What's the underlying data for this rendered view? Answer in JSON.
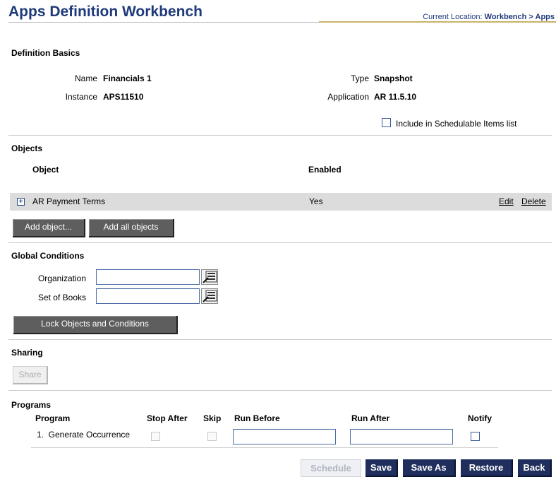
{
  "header": {
    "title": "Apps Definition Workbench",
    "location_label": "Current Location:",
    "location_path": "Workbench > Apps"
  },
  "basics": {
    "section_title": "Definition Basics",
    "name_label": "Name",
    "name_value": "Financials 1",
    "instance_label": "Instance",
    "instance_value": "APS11510",
    "type_label": "Type",
    "type_value": "Snapshot",
    "application_label": "Application",
    "application_value": "AR 11.5.10",
    "schedulable_label": "Include in Schedulable Items list",
    "schedulable_checked": false
  },
  "objects": {
    "section_title": "Objects",
    "col_object": "Object",
    "col_enabled": "Enabled",
    "rows": [
      {
        "name": "AR Payment Terms",
        "enabled": "Yes",
        "edit": "Edit",
        "delete": "Delete"
      }
    ],
    "add_object_label": "Add object...",
    "add_all_label": "Add all objects"
  },
  "global_conditions": {
    "section_title": "Global Conditions",
    "organization_label": "Organization",
    "organization_value": "",
    "set_of_books_label": "Set of Books",
    "set_of_books_value": "",
    "lock_label": "Lock Objects and Conditions"
  },
  "sharing": {
    "section_title": "Sharing",
    "share_label": "Share"
  },
  "programs": {
    "section_title": "Programs",
    "col_program": "Program",
    "col_stop_after": "Stop After",
    "col_skip": "Skip",
    "col_run_before": "Run Before",
    "col_run_after": "Run After",
    "col_notify": "Notify",
    "rows": [
      {
        "program": "1.  Generate Occurrence",
        "run_before": "",
        "run_after": ""
      }
    ]
  },
  "footer": {
    "schedule_label": "Schedule",
    "save_label": "Save",
    "save_as_label": "Save As",
    "restore_label": "Restore",
    "back_label": "Back"
  },
  "colors": {
    "title_blue": "#1f3a7a",
    "dark_button": "#1f2e5c",
    "gray_button": "#5e5e5e",
    "row_band": "#dcdcdc"
  }
}
